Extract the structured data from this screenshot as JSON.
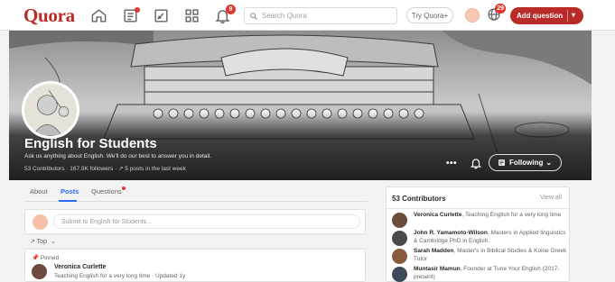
{
  "topbar": {
    "logo": "Quora",
    "nav_icons": [
      "home-icon",
      "following-icon",
      "answer-icon",
      "spaces-icon",
      "notifications-icon"
    ],
    "search_placeholder": "Search Quora",
    "try_label": "Try Quora+",
    "notification_count": "9",
    "globe_count": "29",
    "add_question_label": "Add question"
  },
  "space": {
    "title": "English for Students",
    "description": "Ask us anything about English. We'll do our best to answer you in detail.",
    "meta": "53 Contributors · 167.9K followers · ↗ 5 posts in the last week",
    "more_label": "•••",
    "following_label": "Following"
  },
  "feed": {
    "tabs": [
      {
        "label": "About"
      },
      {
        "label": "Posts"
      },
      {
        "label": "Questions"
      }
    ],
    "composer_placeholder": "Submit to English for Students...",
    "sort_label": "↗ Top",
    "post": {
      "pinned_label": "Pinned",
      "author": "Veronica Curlette",
      "subtitle": "Teaching English for a very long time · Updated 1y"
    }
  },
  "contributors": {
    "title": "53 Contributors",
    "view_all": "View all",
    "items": [
      {
        "name": "Veronica Curlette",
        "desc": "Teaching English for a very long time",
        "color": "#6d4c3d"
      },
      {
        "name": "John R. Yamamoto-Wilson",
        "desc": "Masters in Applied linguistics & Cambridge PhD in English.",
        "color": "#4a4a4a"
      },
      {
        "name": "Sarah Madden",
        "desc": "Master's in Biblical Studies & Koine Greek Tutor",
        "color": "#8a5a40"
      },
      {
        "name": "Muntasir Mamun",
        "desc": "Founder at Tune Your English (2017-present)",
        "color": "#3c4a5a"
      }
    ]
  },
  "colors": {
    "brand": "#b92b27",
    "accent": "#2e69ff",
    "badge": "#e2372d"
  }
}
